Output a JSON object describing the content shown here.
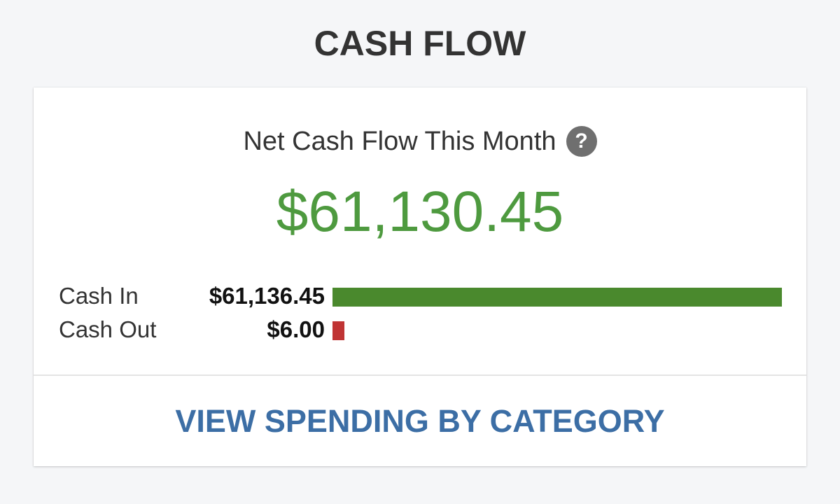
{
  "page": {
    "title": "CASH FLOW"
  },
  "summary": {
    "heading": "Net Cash Flow This Month",
    "help_icon_glyph": "?",
    "help_icon": "question-circle-icon",
    "net_amount": "$61,130.45"
  },
  "rows": [
    {
      "label": "Cash In",
      "value": "$61,136.45",
      "amount": 61136.45,
      "color": "#4a892d"
    },
    {
      "label": "Cash Out",
      "value": "$6.00",
      "amount": 6.0,
      "color": "#c03434"
    }
  ],
  "link": {
    "label": "VIEW SPENDING BY CATEGORY"
  },
  "colors": {
    "net_positive": "#4e9a3f",
    "link": "#3c6ea5"
  }
}
